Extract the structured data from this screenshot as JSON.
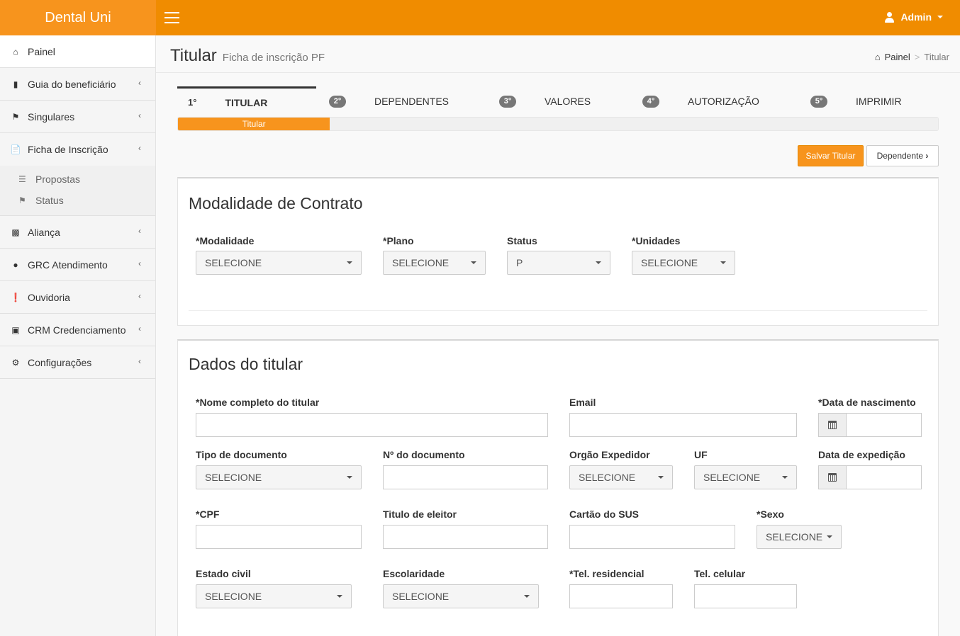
{
  "brand": "Dental Uni",
  "user": {
    "name": "Admin"
  },
  "sidebar": {
    "items": [
      {
        "label": "Painel",
        "icon": "home-icon"
      },
      {
        "label": "Guia do beneficiário",
        "icon": "book-icon"
      },
      {
        "label": "Singulares",
        "icon": "bookmark-icon"
      },
      {
        "label": "Ficha de Inscrição",
        "icon": "file-icon"
      },
      {
        "label": "Aliança",
        "icon": "briefcase-icon"
      },
      {
        "label": "GRC Atendimento",
        "icon": "comment-icon"
      },
      {
        "label": "Ouvidoria",
        "icon": "exclamation-icon"
      },
      {
        "label": "CRM Credenciamento",
        "icon": "toolbox-icon"
      },
      {
        "label": "Configurações",
        "icon": "gears-icon"
      }
    ],
    "subitems": [
      {
        "label": "Propostas",
        "icon": "list-icon"
      },
      {
        "label": "Status",
        "icon": "flag-icon"
      }
    ]
  },
  "header": {
    "title": "Titular",
    "subtitle": "Ficha de inscrição PF",
    "breadcrumb": {
      "home": "Painel",
      "current": "Titular"
    }
  },
  "wizard": {
    "steps": [
      {
        "num": "1°",
        "label": "TITULAR"
      },
      {
        "num": "2°",
        "label": "DEPENDENTES"
      },
      {
        "num": "3°",
        "label": "VALORES"
      },
      {
        "num": "4°",
        "label": "AUTORIZAÇÃO"
      },
      {
        "num": "5°",
        "label": "IMPRIMIR"
      }
    ],
    "progress_label": "Titular",
    "progress_fraction": 0.2
  },
  "buttons": {
    "save": "Salvar Titular",
    "next": "Dependente"
  },
  "contract": {
    "title": "Modalidade de Contrato",
    "modalidade": {
      "label": "*Modalidade",
      "value": "SELECIONE"
    },
    "plano": {
      "label": "*Plano",
      "value": "SELECIONE"
    },
    "status": {
      "label": "Status",
      "value": "P"
    },
    "unidades": {
      "label": "*Unidades",
      "value": "SELECIONE"
    }
  },
  "holder": {
    "title": "Dados do titular",
    "nome": {
      "label": "*Nome completo do titular",
      "value": ""
    },
    "email": {
      "label": "Email",
      "value": ""
    },
    "nascimento": {
      "label": "*Data de nascimento",
      "value": ""
    },
    "tipo_doc": {
      "label": "Tipo de documento",
      "value": "SELECIONE"
    },
    "num_doc": {
      "label": "Nº do documento",
      "value": ""
    },
    "orgao": {
      "label": "Orgão Expedidor",
      "value": "SELECIONE"
    },
    "uf": {
      "label": "UF",
      "value": "SELECIONE"
    },
    "expedicao": {
      "label": "Data de expedição",
      "value": ""
    },
    "cpf": {
      "label": "*CPF",
      "value": ""
    },
    "titulo": {
      "label": "Titulo de eleitor",
      "value": ""
    },
    "sus": {
      "label": "Cartão do SUS",
      "value": ""
    },
    "sexo": {
      "label": "*Sexo",
      "value": "SELECIONE"
    },
    "estado_civil": {
      "label": "Estado civil",
      "value": "SELECIONE"
    },
    "escolaridade": {
      "label": "Escolaridade",
      "value": "SELECIONE"
    },
    "tel_res": {
      "label": "*Tel. residencial",
      "value": ""
    },
    "tel_cel": {
      "label": "Tel. celular",
      "value": ""
    }
  },
  "colors": {
    "brand": "#f7941d",
    "topbar": "#f08c00"
  }
}
